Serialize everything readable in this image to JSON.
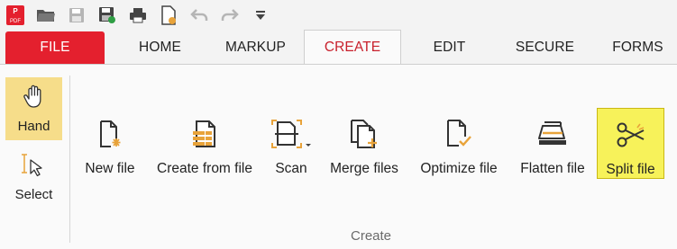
{
  "quick_access": {
    "items": [
      {
        "icon": "pdf-app-logo-icon",
        "label": "PDF"
      },
      {
        "icon": "open-folder-icon"
      },
      {
        "icon": "save-icon"
      },
      {
        "icon": "save-as-icon"
      },
      {
        "icon": "print-icon"
      },
      {
        "icon": "document-properties-icon"
      },
      {
        "icon": "undo-icon"
      },
      {
        "icon": "redo-icon"
      },
      {
        "icon": "customize-dropdown-icon"
      }
    ]
  },
  "tabs": [
    {
      "label": "FILE",
      "active": false
    },
    {
      "label": "HOME",
      "active": false
    },
    {
      "label": "MARKUP",
      "active": false
    },
    {
      "label": "CREATE",
      "active": true
    },
    {
      "label": "EDIT",
      "active": false
    },
    {
      "label": "SECURE",
      "active": false
    },
    {
      "label": "FORMS",
      "active": false
    }
  ],
  "ribbon": {
    "side_tools": [
      {
        "label": "Hand",
        "icon": "hand-icon",
        "selected": true
      },
      {
        "label": "Select",
        "icon": "select-cursor-icon",
        "selected": false
      }
    ],
    "tools": [
      {
        "label": "New file",
        "icon": "new-file-icon"
      },
      {
        "label": "Create from file",
        "icon": "create-from-file-icon"
      },
      {
        "label": "Scan",
        "icon": "scan-icon"
      },
      {
        "label": "Merge files",
        "icon": "merge-files-icon"
      },
      {
        "label": "Optimize file",
        "icon": "optimize-file-icon"
      },
      {
        "label": "Flatten file",
        "icon": "flatten-file-icon"
      },
      {
        "label": "Split file",
        "icon": "split-file-icon",
        "highlighted": true
      }
    ],
    "group_label": "Create"
  },
  "colors": {
    "file_tab": "#e4202e",
    "active_tab_text": "#c8202c",
    "hand_selected": "#f6dd8a",
    "split_highlight": "#f7f25a",
    "icon_orange": "#e8a33a"
  }
}
